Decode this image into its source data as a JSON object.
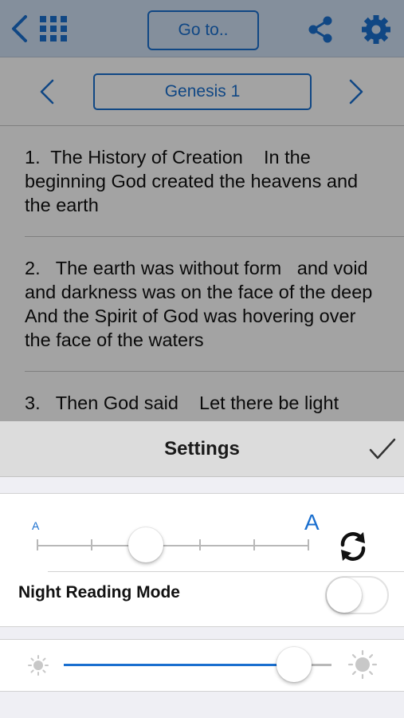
{
  "toolbar": {
    "goto_label": "Go to..",
    "icons": [
      "chevron-left-icon",
      "grid-icon",
      "share-icon",
      "gear-icon"
    ],
    "accent_color": "#1a6fcf"
  },
  "chapter_nav": {
    "title": "Genesis 1",
    "icons": [
      "chevron-left-icon",
      "chevron-right-icon"
    ]
  },
  "verses": [
    "1.  The History of Creation    In the beginning God created the heavens and the earth",
    "2.   The earth was without form   and void  and darkness was on the face of the deep  And the Spirit of God was hovering over the face of the waters",
    "3.   Then God said    Let there be light"
  ],
  "settings": {
    "title": "Settings",
    "done_icon": "checkmark-icon",
    "font_size": {
      "small_label": "A",
      "large_label": "A",
      "level": 0.4,
      "steps": 6,
      "reset_icon": "refresh-icon"
    },
    "night_mode": {
      "label": "Night Reading Mode",
      "enabled": false
    },
    "brightness": {
      "level": 0.86,
      "low_icon": "sun-small-icon",
      "high_icon": "sun-large-icon"
    }
  }
}
